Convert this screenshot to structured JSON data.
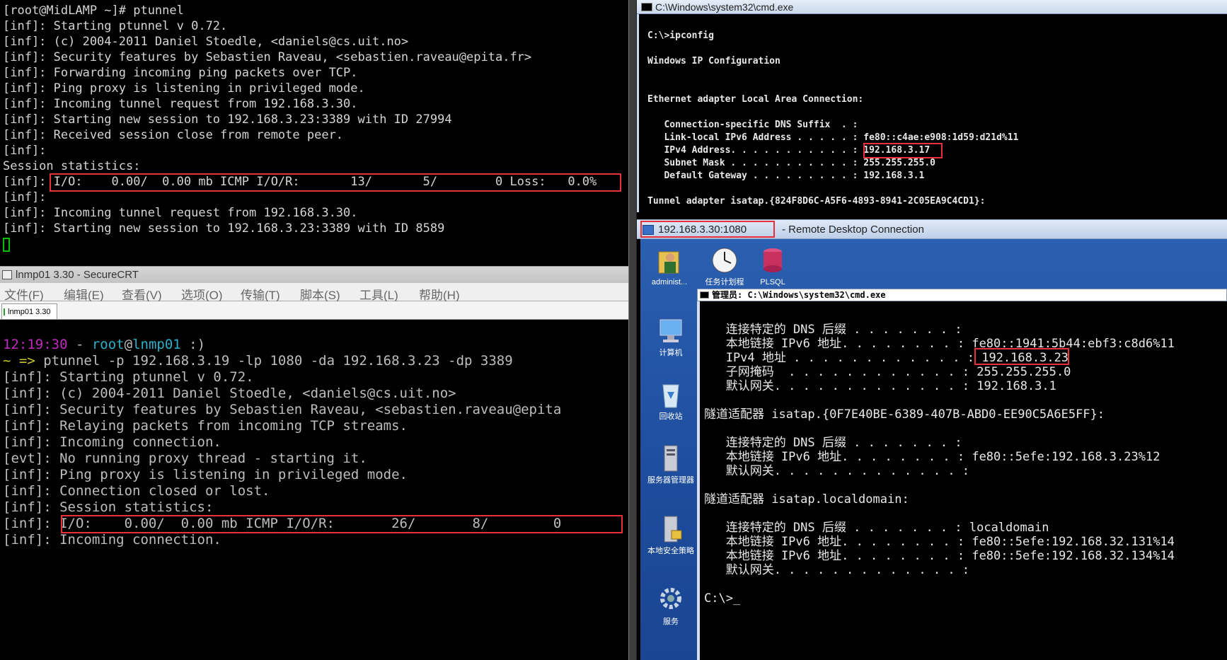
{
  "pane_top_left": {
    "lines": [
      "[root@MidLAMP ~]# ptunnel",
      "[inf]: Starting ptunnel v 0.72.",
      "[inf]: (c) 2004-2011 Daniel Stoedle, <daniels@cs.uit.no>",
      "[inf]: Security features by Sebastien Raveau, <sebastien.raveau@epita.fr>",
      "[inf]: Forwarding incoming ping packets over TCP.",
      "[inf]: Ping proxy is listening in privileged mode.",
      "[inf]: Incoming tunnel request from 192.168.3.30.",
      "[inf]: Starting new session to 192.168.3.23:3389 with ID 27994",
      "[inf]: Received session close from remote peer.",
      "[inf]:",
      "Session statistics:",
      "[inf]: I/O:    0.00/  0.00 mb ICMP I/O/R:       13/       5/        0 Loss:   0.0%",
      "[inf]:",
      "[inf]: Incoming tunnel request from 192.168.3.30.",
      "[inf]: Starting new session to 192.168.3.23:3389 with ID 8589"
    ]
  },
  "securecrt": {
    "title": "lnmp01 3.30 - SecureCRT",
    "menu": [
      "文件(F)",
      "编辑(E)",
      "查看(V)",
      "选项(O)",
      "传输(T)",
      "脚本(S)",
      "工具(L)",
      "帮助(H)"
    ],
    "tab": "lnmp01 3.30",
    "prompt": {
      "time": "12:19:30",
      "dash": " - ",
      "user": "root",
      "at": "@",
      "host": "lnmp01",
      "tail": " :)"
    },
    "cmd_prefix": "~ =>",
    "command": " ptunnel -p 192.168.3.19 -lp 1080 -da 192.168.3.23 -dp 3389",
    "lines": [
      "[inf]: Starting ptunnel v 0.72.",
      "[inf]: (c) 2004-2011 Daniel Stoedle, <daniels@cs.uit.no>",
      "[inf]: Security features by Sebastien Raveau, <sebastien.raveau@epita",
      "[inf]: Relaying packets from incoming TCP streams.",
      "[inf]: Incoming connection.",
      "[evt]: No running proxy thread - starting it.",
      "[inf]: Ping proxy is listening in privileged mode.",
      "[inf]: Connection closed or lost.",
      "[inf]: Session statistics:",
      "[inf]: I/O:    0.00/  0.00 mb ICMP I/O/R:       26/       8/        0",
      "[inf]: Incoming connection."
    ]
  },
  "cmd_top_right": {
    "title": "C:\\Windows\\system32\\cmd.exe",
    "lines": [
      "C:\\>ipconfig",
      "",
      "Windows IP Configuration",
      "",
      "",
      "Ethernet adapter Local Area Connection:",
      "",
      "   Connection-specific DNS Suffix  . :",
      "   Link-local IPv6 Address . . . . . : fe80::c4ae:e908:1d59:d21d%11",
      "   IPv4 Address. . . . . . . . . . . : 192.168.3.17",
      "   Subnet Mask . . . . . . . . . . . : 255.255.255.0",
      "   Default Gateway . . . . . . . . . : 192.168.3.1",
      "",
      "Tunnel adapter isatap.{824F8D6C-A5F6-4893-8941-2C05EA9C4CD1}:"
    ]
  },
  "rdp": {
    "address": "192.168.3.30:1080",
    "title": "- Remote Desktop Connection",
    "desktop_icons": [
      "administ...",
      "任务计划程",
      "PLSQL",
      "计算机",
      "回收站",
      "服务器管理器",
      "本地安全策略",
      "服务"
    ],
    "inner_cmd_title": "管理员: C:\\Windows\\system32\\cmd.exe",
    "inner_lines": [
      "",
      "   连接特定的 DNS 后缀 . . . . . . . :",
      "   本地链接 IPv6 地址. . . . . . . . : fe80::1941:5b44:ebf3:c8d6%11",
      "   IPv4 地址 . . . . . . . . . . . . : 192.168.3.23",
      "   子网掩码  . . . . . . . . . . . . : 255.255.255.0",
      "   默认网关. . . . . . . . . . . . . : 192.168.3.1",
      "",
      "隧道适配器 isatap.{0F7E40BE-6389-407B-ABD0-EE90C5A6E5FF}:",
      "",
      "   连接特定的 DNS 后缀 . . . . . . . :",
      "   本地链接 IPv6 地址. . . . . . . . : fe80::5efe:192.168.3.23%12",
      "   默认网关. . . . . . . . . . . . . :",
      "",
      "隧道适配器 isatap.localdomain:",
      "",
      "   连接特定的 DNS 后缀 . . . . . . . : localdomain",
      "   本地链接 IPv6 地址. . . . . . . . : fe80::5efe:192.168.32.131%14",
      "   本地链接 IPv6 地址. . . . . . . . : fe80::5efe:192.168.32.134%14",
      "   默认网关. . . . . . . . . . . . . :",
      "",
      "C:\\>_"
    ]
  },
  "colors": {
    "highlight": "#e8303a",
    "cursor_green": "#00c000"
  }
}
